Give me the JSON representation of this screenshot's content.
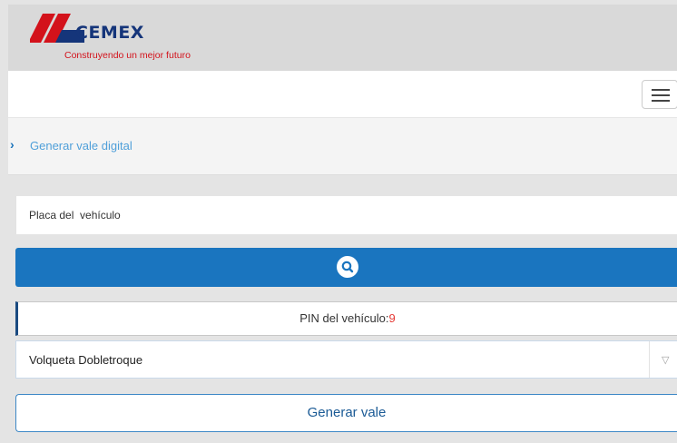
{
  "header": {
    "logo_text": "CEMEX",
    "tagline": "Construyendo un mejor futuro"
  },
  "icons": {
    "menu": "hamburger-icon",
    "breadcrumb": "chevron-right-icon",
    "search": "search-icon",
    "dropdown": "triangle-down-icon"
  },
  "breadcrumb": {
    "arrow": "›",
    "label": "Generar vale digital"
  },
  "form": {
    "plate_placeholder": "Placa del  vehículo",
    "plate_value": "",
    "pin_label": "PIN del vehículo:",
    "pin_value": "9",
    "vehicle_type": "Volqueta Dobletroque",
    "dropdown_arrow": "▽",
    "generate_label": "Generar vale"
  },
  "colors": {
    "brand_blue": "#15357a",
    "brand_red": "#d3121b",
    "accent_blue": "#1a75bf",
    "link_blue": "#4f9fd9",
    "pin_red": "#e53935"
  }
}
